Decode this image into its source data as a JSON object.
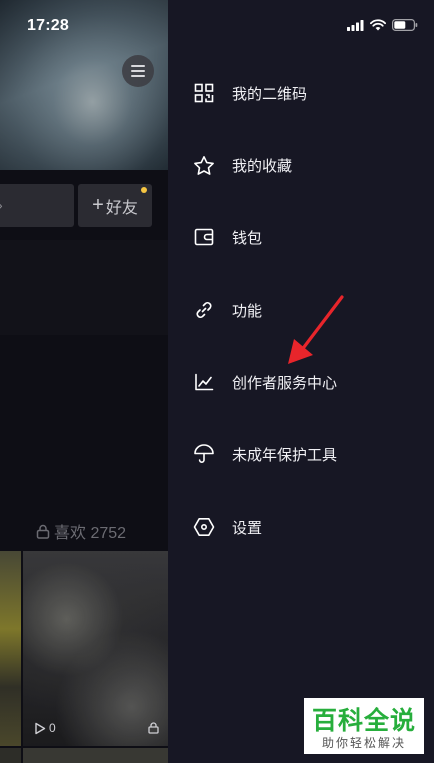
{
  "status_bar": {
    "time": "17:28"
  },
  "profile": {
    "add_friend_label": "好友",
    "add_friend_prefix": "+",
    "likes_label": "喜欢 2752",
    "video_views": "0"
  },
  "drawer": {
    "items": [
      {
        "label": "我的二维码",
        "icon": "qr-code-icon"
      },
      {
        "label": "我的收藏",
        "icon": "star-icon"
      },
      {
        "label": "钱包",
        "icon": "wallet-icon"
      },
      {
        "label": "功能",
        "icon": "link-icon"
      },
      {
        "label": "创作者服务中心",
        "icon": "chart-icon"
      },
      {
        "label": "未成年保护工具",
        "icon": "umbrella-icon"
      },
      {
        "label": "设置",
        "icon": "settings-hexagon-icon"
      }
    ]
  },
  "annotation": {
    "arrow_color": "#e8252b"
  },
  "watermark": {
    "title": "百科全说",
    "subtitle": "助你轻松解决",
    "color": "#27ae3c"
  },
  "colors": {
    "drawer_bg": "#171724",
    "page_bg": "#0e0e15"
  }
}
